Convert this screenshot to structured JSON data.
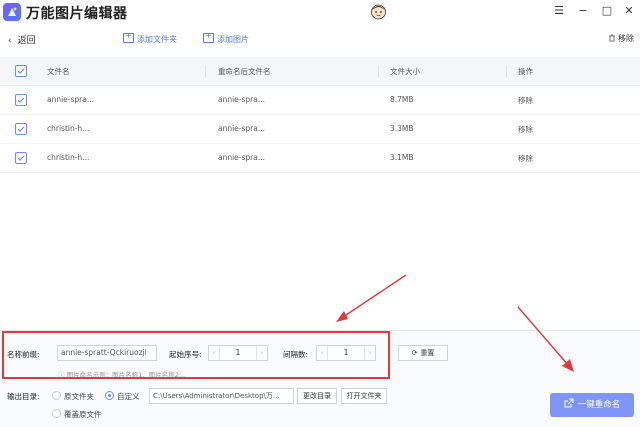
{
  "app": {
    "title": "万能图片编辑器"
  },
  "window_controls": {
    "menu": "☰",
    "minimize": "−",
    "maximize": "□",
    "close": "✕"
  },
  "toolbar": {
    "back_label": "返回",
    "add_folder_label": "添加文件夹",
    "add_image_label": "添加图片",
    "remove_label": "移除"
  },
  "table": {
    "headers": [
      "文件名",
      "重命名后文件名",
      "文件大小",
      "操作"
    ],
    "rows": [
      {
        "name": "annie-spra...",
        "renamed": "annie-spra...",
        "size": "8.7MB",
        "action": "移除"
      },
      {
        "name": "christin-h...",
        "renamed": "annie-spra...",
        "size": "3.3MB",
        "action": "移除"
      },
      {
        "name": "christin-h...",
        "renamed": "annie-spra...",
        "size": "3.1MB",
        "action": "移除"
      }
    ]
  },
  "rename": {
    "prefix_label": "名称前缀:",
    "prefix_value": "annie-spratt-Qckiruozjl",
    "start_label": "起始序号:",
    "start_value": "1",
    "interval_label": "间隔数:",
    "interval_value": "1",
    "reset_label": "重置",
    "example_hint": "ⓘ 图片命名示例：图片名称1、图片名称2..."
  },
  "output": {
    "label": "输出目录:",
    "option_original": "原文件夹",
    "option_custom": "自定义",
    "path_value": "C:\\Users\\Administrator\\Desktop\\万...",
    "change_dir_label": "更改目录",
    "open_folder_label": "打开文件夹",
    "overwrite_label": "覆盖原文件"
  },
  "primary_action": {
    "label": "一键重命名"
  },
  "colors": {
    "accent": "#6b8cf0",
    "primary_button": "#7f95f6",
    "highlight_box": "#e0393e"
  }
}
